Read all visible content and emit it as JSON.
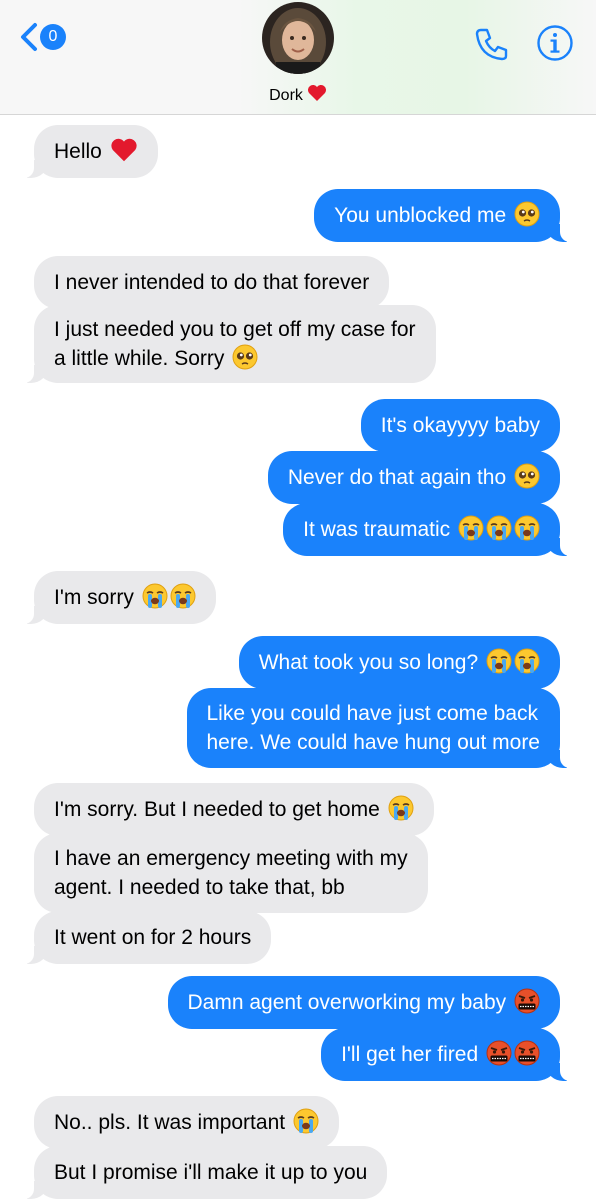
{
  "header": {
    "back_badge": "0",
    "contact_name": "Dork",
    "contact_name_emoji": "red-heart-icon"
  },
  "colors": {
    "outgoing_bubble": "#1a82fb",
    "incoming_bubble": "#e9e9eb",
    "accent": "#1a82fb"
  },
  "messages": [
    {
      "from": "them",
      "text": "Hello",
      "emojis": [
        "red-heart"
      ]
    },
    {
      "from": "me",
      "text": "You unblocked me",
      "emojis": [
        "pleading-face"
      ]
    },
    {
      "from": "them",
      "text": "I never intended to do that forever",
      "emojis": []
    },
    {
      "from": "them",
      "text_lines": [
        "I just needed you to get off my case for",
        "a little while. Sorry"
      ],
      "emojis": [
        "pleading-face"
      ]
    },
    {
      "from": "me",
      "text": "It's okayyyy baby",
      "emojis": []
    },
    {
      "from": "me",
      "text": "Never do that again tho",
      "emojis": [
        "pleading-face"
      ]
    },
    {
      "from": "me",
      "text": "It was traumatic",
      "emojis": [
        "loudly-crying-face",
        "loudly-crying-face",
        "loudly-crying-face"
      ]
    },
    {
      "from": "them",
      "text": "I'm sorry",
      "emojis": [
        "loudly-crying-face",
        "loudly-crying-face"
      ]
    },
    {
      "from": "me",
      "text": "What took you so long?",
      "emojis": [
        "loudly-crying-face",
        "loudly-crying-face"
      ]
    },
    {
      "from": "me",
      "text_lines": [
        "Like you could have just come back",
        "here. We could have hung out more"
      ],
      "emojis": []
    },
    {
      "from": "them",
      "text": "I'm sorry. But I needed to get home",
      "emojis": [
        "loudly-crying-face"
      ]
    },
    {
      "from": "them",
      "text_lines": [
        "I have an emergency meeting with my",
        "agent. I needed to take that, bb"
      ],
      "emojis": []
    },
    {
      "from": "them",
      "text": "It went on for 2 hours",
      "emojis": []
    },
    {
      "from": "me",
      "text": "Damn agent overworking my baby",
      "emojis": [
        "face-with-symbols-on-mouth"
      ]
    },
    {
      "from": "me",
      "text": "I'll get her fired",
      "emojis": [
        "face-with-symbols-on-mouth",
        "face-with-symbols-on-mouth"
      ]
    },
    {
      "from": "them",
      "text": "No.. pls. It was important",
      "emojis": [
        "loudly-crying-face"
      ]
    },
    {
      "from": "them",
      "text": "But I promise i'll make it up to you",
      "emojis": []
    }
  ]
}
